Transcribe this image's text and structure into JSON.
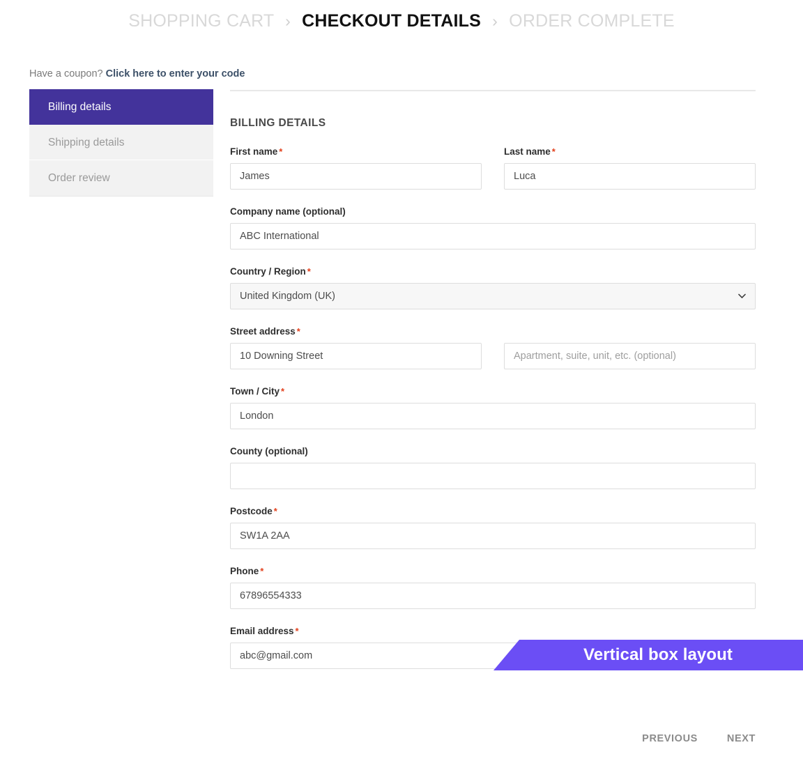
{
  "breadcrumb": {
    "separator": "›",
    "steps": [
      {
        "label": "SHOPPING CART",
        "active": false
      },
      {
        "label": "CHECKOUT DETAILS",
        "active": true
      },
      {
        "label": "ORDER COMPLETE",
        "active": false
      }
    ]
  },
  "coupon": {
    "prompt": "Have a coupon?",
    "link_label": "Click here to enter your code"
  },
  "sidebar": {
    "items": [
      {
        "label": "Billing details",
        "active": true
      },
      {
        "label": "Shipping details",
        "active": false
      },
      {
        "label": "Order review",
        "active": false
      }
    ]
  },
  "form": {
    "title": "BILLING DETAILS",
    "required_marker": "*",
    "fields": {
      "first_name": {
        "label": "First name",
        "value": "James",
        "placeholder": ""
      },
      "last_name": {
        "label": "Last name",
        "value": "Luca",
        "placeholder": ""
      },
      "company": {
        "label": "Company name (optional)",
        "value": "ABC International",
        "placeholder": ""
      },
      "country": {
        "label": "Country / Region",
        "value": "United Kingdom (UK)"
      },
      "street": {
        "label": "Street address",
        "value": "10 Downing Street",
        "placeholder": ""
      },
      "address2": {
        "label": "",
        "value": "",
        "placeholder": "Apartment, suite, unit, etc. (optional)"
      },
      "city": {
        "label": "Town / City",
        "value": "London",
        "placeholder": ""
      },
      "county": {
        "label": "County (optional)",
        "value": "",
        "placeholder": ""
      },
      "postcode": {
        "label": "Postcode",
        "value": "SW1A 2AA",
        "placeholder": ""
      },
      "phone": {
        "label": "Phone",
        "value": "67896554333",
        "placeholder": ""
      },
      "email": {
        "label": "Email address",
        "value": "abc@gmail.com",
        "placeholder": ""
      }
    }
  },
  "ribbon": {
    "text": "Vertical box layout"
  },
  "footer": {
    "previous_label": "PREVIOUS",
    "next_label": "NEXT"
  },
  "colors": {
    "active_tab": "#43339b",
    "ribbon": "#6b4ef5",
    "required": "#e2401c",
    "link": "#3c5068"
  }
}
